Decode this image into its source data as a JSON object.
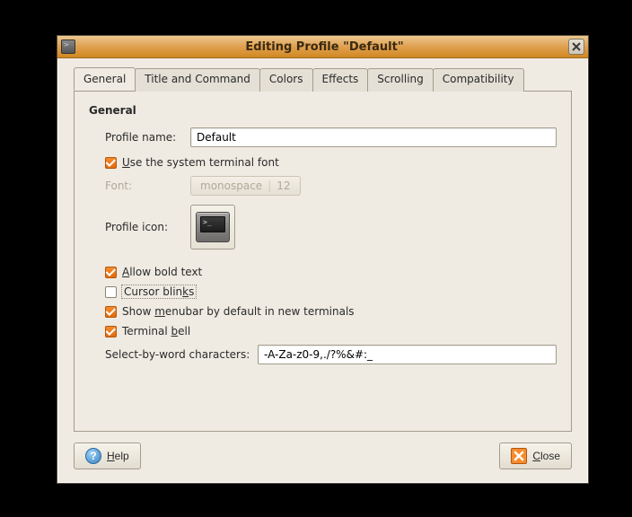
{
  "window": {
    "title": "Editing Profile \"Default\""
  },
  "tabs": [
    {
      "label": "General"
    },
    {
      "label": "Title and Command"
    },
    {
      "label": "Colors"
    },
    {
      "label": "Effects"
    },
    {
      "label": "Scrolling"
    },
    {
      "label": "Compatibility"
    }
  ],
  "section": {
    "title": "General"
  },
  "fields": {
    "profile_name_label": "Profile name:",
    "profile_name_value": "Default",
    "use_system_font_label_pre": "U",
    "use_system_font_label_rest": "se the system terminal font",
    "font_label_pre": "F",
    "font_label_rest": "ont:",
    "font_button_name": "monospace",
    "font_button_size": "12",
    "profile_icon_label": "Profile icon:",
    "allow_bold_pre": "A",
    "allow_bold_rest": "llow bold text",
    "cursor_blinks_pre": "Cursor blin",
    "cursor_blinks_mn": "k",
    "cursor_blinks_rest": "s",
    "show_menubar_pre": "Show ",
    "show_menubar_mn": "m",
    "show_menubar_rest": "enubar by default in new terminals",
    "terminal_bell_pre": "Terminal ",
    "terminal_bell_mn": "b",
    "terminal_bell_rest": "ell",
    "select_by_word_label_pre": "Select-by-",
    "select_by_word_label_mn": "w",
    "select_by_word_label_rest": "ord characters:",
    "select_by_word_value": "-A-Za-z0-9,./?%&#:_"
  },
  "buttons": {
    "help_pre": "H",
    "help_rest": "elp",
    "close_pre": "C",
    "close_rest": "lose"
  }
}
